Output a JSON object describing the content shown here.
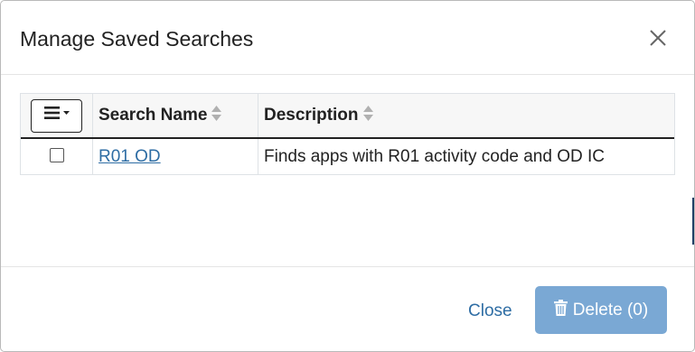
{
  "dialog": {
    "title": "Manage Saved Searches",
    "close_icon": "close-icon"
  },
  "table": {
    "menu_icon": "hamburger-menu-icon",
    "columns": [
      {
        "label": "Search Name",
        "sortable": true
      },
      {
        "label": "Description",
        "sortable": true
      }
    ],
    "rows": [
      {
        "checked": false,
        "name": "R01 OD",
        "description": "Finds apps with R01 activity code and OD IC"
      }
    ]
  },
  "footer": {
    "close_label": "Close",
    "delete_label": "Delete (0)",
    "delete_icon": "trash-icon",
    "delete_enabled": false
  },
  "colors": {
    "link": "#2e6da4",
    "delete_button_disabled": "#7aa8d4",
    "header_bg": "#f7f7f7"
  }
}
